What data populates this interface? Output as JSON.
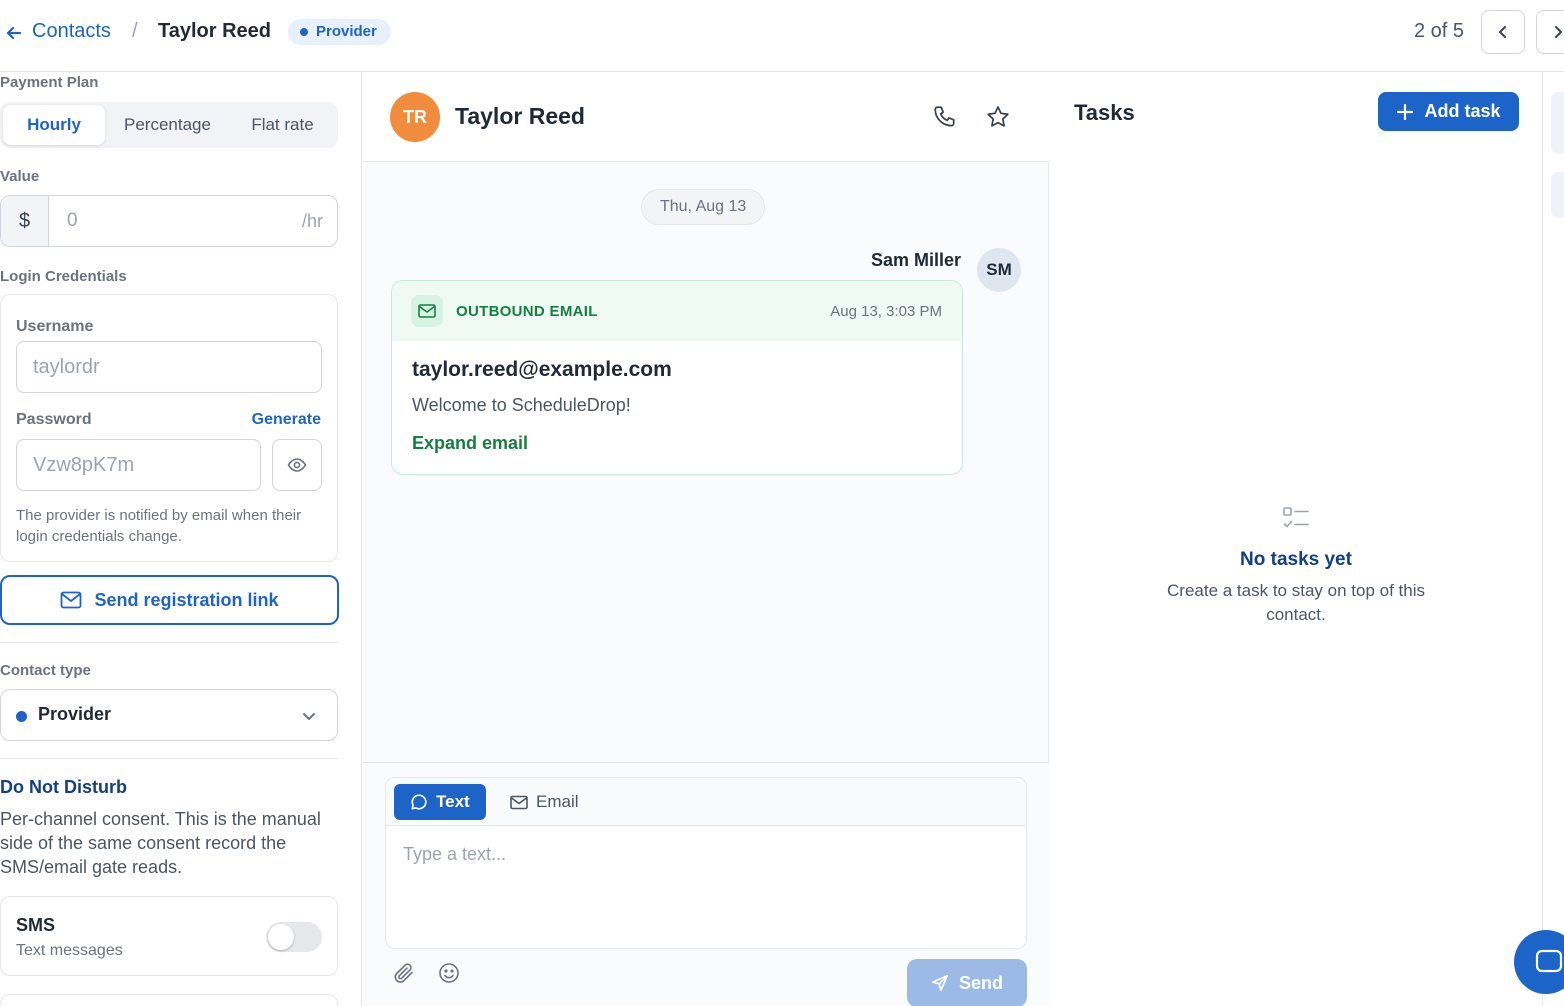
{
  "breadcrumb": {
    "back_link": "Contacts",
    "separator": "/",
    "current": "Taylor Reed",
    "badge": "Provider"
  },
  "pager": {
    "text": "2 of 5"
  },
  "left_panel": {
    "payment_plan": {
      "label": "Payment Plan",
      "options": [
        "Hourly",
        "Percentage",
        "Flat rate"
      ],
      "selected": "Hourly"
    },
    "value": {
      "label": "Value",
      "prefix": "$",
      "input_value": "0",
      "suffix": "/hr"
    },
    "login_credentials": {
      "label": "Login Credentials",
      "username_label": "Username",
      "username_value": "taylordr",
      "password_label": "Password",
      "generate_label": "Generate",
      "password_value": "Vzw8pK7m",
      "hint": "The provider is notified by email when their login credentials change."
    },
    "send_registration_label": "Send registration link",
    "contact_type": {
      "label": "Contact type",
      "value": "Provider",
      "dot_color": "#1d64c8"
    },
    "dnd": {
      "title": "Do Not Disturb",
      "description": "Per-channel consent. This is the manual side of the same consent record the SMS/email gate reads."
    },
    "sms": {
      "title": "SMS",
      "subtitle": "Text messages",
      "enabled": false
    }
  },
  "conversation": {
    "contact_initials": "TR",
    "contact_name": "Taylor Reed",
    "avatar_color": "#f08c3c",
    "date_divider": "Thu, Aug 13",
    "sender_name": "Sam Miller",
    "sender_initials": "SM",
    "email": {
      "kind": "OUTBOUND EMAIL",
      "time": "Aug 13, 3:03 PM",
      "to": "taylor.reed@example.com",
      "subject": "Welcome to ScheduleDrop!",
      "expand_label": "Expand email"
    },
    "composer": {
      "tabs": [
        "Text",
        "Email"
      ],
      "active_tab": "Text",
      "placeholder": "Type a text...",
      "send_label": "Send"
    }
  },
  "tasks": {
    "title": "Tasks",
    "add_label": "Add task",
    "empty_title": "No tasks yet",
    "empty_desc": "Create a task to stay on top of this contact."
  },
  "colors": {
    "accent": "#1d64c8",
    "email_green": "#15803d",
    "send_disabled": "#9bbbe6"
  }
}
